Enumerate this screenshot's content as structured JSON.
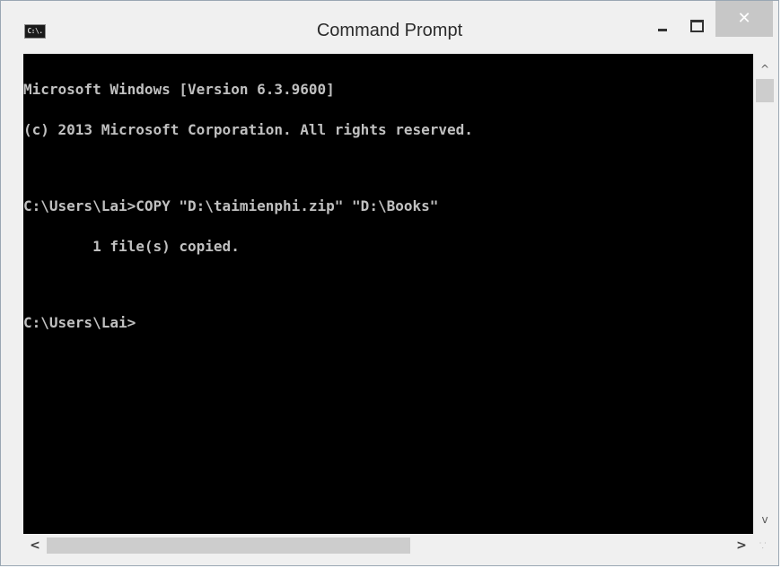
{
  "window": {
    "title": "Command Prompt",
    "icon_label": "C:\\.",
    "icon": "cmd-icon",
    "close_glyph": "✕"
  },
  "console": {
    "lines": [
      "Microsoft Windows [Version 6.3.9600]",
      "(c) 2013 Microsoft Corporation. All rights reserved.",
      "",
      "C:\\Users\\Lai>COPY \"D:\\taimienphi.zip\" \"D:\\Books\"",
      "        1 file(s) copied.",
      "",
      "C:\\Users\\Lai>"
    ]
  },
  "colors": {
    "console_bg": "#000000",
    "console_fg": "#c0c0c0",
    "chrome_bg": "#f0f0f0",
    "close_button": "#c7c7c7"
  },
  "scrollbars": {
    "up_arrow": "^",
    "down_arrow": "v",
    "left_arrow": "<",
    "right_arrow": ">"
  }
}
